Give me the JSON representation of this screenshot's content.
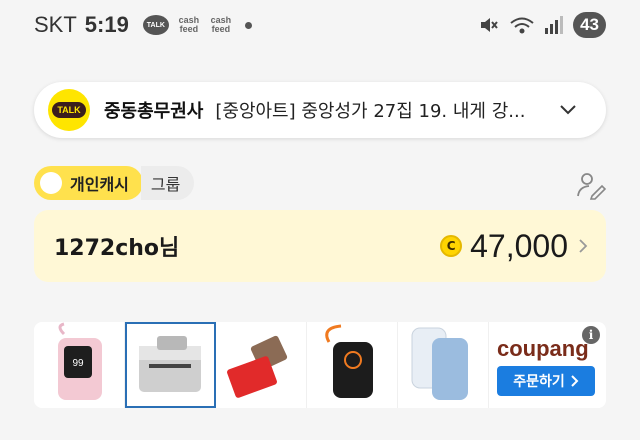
{
  "statusbar": {
    "carrier": "SKT",
    "time": "5:19",
    "talk_label": "TALK",
    "cashfeed_1": "cash feed",
    "cashfeed_2": "cash feed",
    "battery": "43",
    "icons": [
      "mute-icon",
      "wifi-icon",
      "signal-icon"
    ]
  },
  "notification": {
    "app_logo_text": "TALK",
    "sender": "중동총무권사",
    "message": "[중앙아트] 중앙성가 27집 19. 내게 강...",
    "accent": "#fee500"
  },
  "tabs": {
    "active_label": "개인캐시",
    "inactive_label": "그룹"
  },
  "cash": {
    "username": "1272cho님",
    "coin_symbol": "C",
    "amount": "47,000"
  },
  "ad": {
    "brand": "coupang",
    "cta": "주문하기",
    "info": "i",
    "products": [
      "pink-powerbank",
      "grey-printer",
      "red-card-case",
      "black-powerbank",
      "blue-powerbank"
    ]
  },
  "colors": {
    "yellow": "#ffe14d",
    "card_bg": "#fff8d6",
    "coupang_blue": "#1b7de0"
  }
}
